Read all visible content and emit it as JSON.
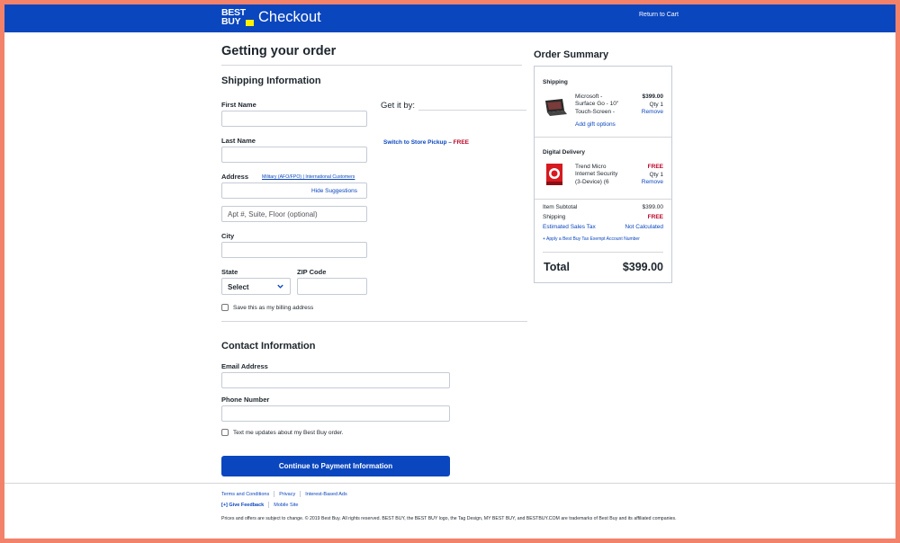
{
  "header": {
    "logo_line1": "BEST",
    "logo_line2": "BUY",
    "title": "Checkout",
    "return_link": "Return to Cart"
  },
  "page_title": "Getting your order",
  "shipping": {
    "heading": "Shipping Information",
    "first_name_label": "First Name",
    "last_name_label": "Last Name",
    "address_label": "Address",
    "address_links": "Military (AFO/FPO) | International Customers",
    "hide_suggestions": "Hide Suggestions",
    "apt_placeholder": "Apt #, Suite, Floor (optional)",
    "city_label": "City",
    "state_label": "State",
    "state_value": "Select",
    "zip_label": "ZIP Code",
    "billing_checkbox_label": "Save this as my billing address",
    "get_it_by": "Get it by:",
    "switch_pickup": "Switch to Store Pickup – ",
    "switch_free": "FREE"
  },
  "contact": {
    "heading": "Contact Information",
    "email_label": "Email Address",
    "phone_label": "Phone Number",
    "text_updates_label": "Text me updates about my Best Buy order."
  },
  "continue_button": "Continue to Payment Information",
  "order_summary": {
    "title": "Order Summary",
    "shipping_heading": "Shipping",
    "item1": {
      "name_line1": "Microsoft -",
      "name_line2": "Surface Go - 10\"",
      "name_line3": "Touch-Screen -",
      "price": "$399.00",
      "qty": "Qty 1",
      "remove": "Remove",
      "gift": "Add gift options"
    },
    "digital_heading": "Digital Delivery",
    "item2": {
      "name_line1": "Trend Micro",
      "name_line2": "Internet Security",
      "name_line3": "(3-Device) (6",
      "price": "FREE",
      "qty": "Qty 1",
      "remove": "Remove"
    },
    "subtotal_label": "Item Subtotal",
    "subtotal_value": "$399.00",
    "shipping_label": "Shipping",
    "shipping_value": "FREE",
    "tax_label": "Estimated Sales Tax",
    "tax_value": "Not Calculated",
    "tax_exempt": "+ Apply a Best Buy Tax Exempt Account Number",
    "total_label": "Total",
    "total_value": "$399.00"
  },
  "footer": {
    "terms": "Terms and Conditions",
    "privacy": "Privacy",
    "ads": "Interest-Based Ads",
    "feedback_prefix": "[+]",
    "feedback": "Give Feedback",
    "mobile": "Mobile Site",
    "legal": "Prices and offers are subject to change. © 2019 Best Buy. All rights reserved. BEST BUY, the BEST BUY logo, the Tag Design, MY BEST BUY, and BESTBUY.COM are trademarks of Best Buy and its affiliated companies."
  },
  "colors": {
    "brand_blue": "#0a46be",
    "brand_yellow": "#fff200",
    "sale_red": "#bb0628",
    "border_frame": "#f3826a"
  }
}
